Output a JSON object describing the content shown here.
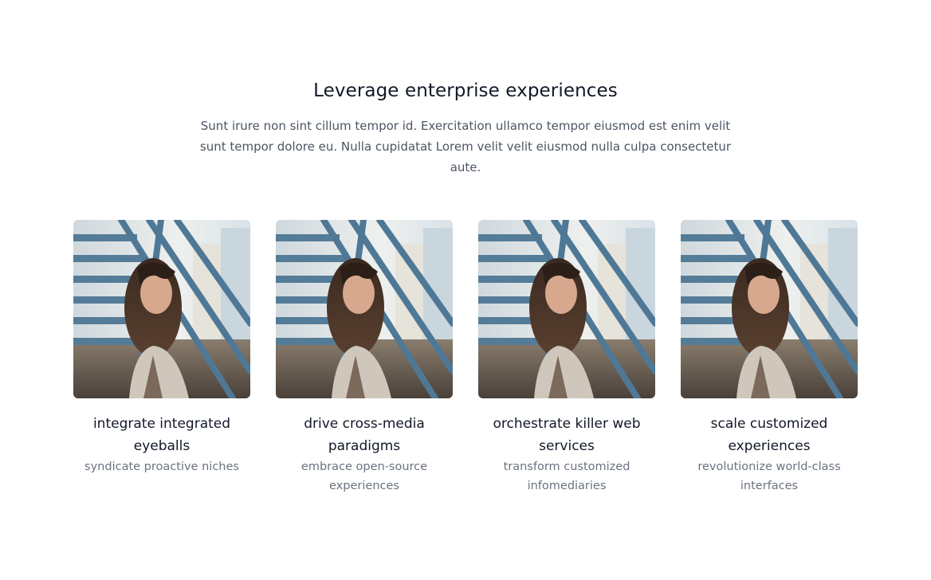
{
  "header": {
    "title": "Leverage enterprise experiences",
    "description": "Sunt irure non sint cillum tempor id. Exercitation ullamco tempor eiusmod est enim velit sunt tempor dolore eu. Nulla cupidatat Lorem velit velit eiusmod nulla culpa consectetur aute."
  },
  "team": [
    {
      "name": "integrate integrated eyeballs",
      "role": "syndicate proactive niches"
    },
    {
      "name": "drive cross-media paradigms",
      "role": "embrace open-source experiences"
    },
    {
      "name": "orchestrate killer web services",
      "role": "transform customized infomediaries"
    },
    {
      "name": "scale customized experiences",
      "role": "revolutionize world-class interfaces"
    }
  ],
  "colors": {
    "heading": "#111827",
    "body": "#4b5563",
    "muted": "#6b7280",
    "stairs": "#4f7896"
  }
}
